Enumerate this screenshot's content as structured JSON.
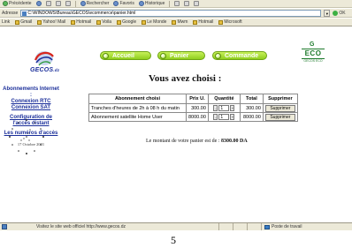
{
  "browser": {
    "toolbar": [
      "Précédente",
      "Rechercher",
      "Favoris",
      "Historique"
    ],
    "address_label": "Adresse",
    "address_value": "C:\\WINDOWS\\Bureau\\GECOS\\ecommerce\\panier.html",
    "go_label": "OK",
    "links": [
      "Link",
      "Gmail",
      "Yahoo! Mail",
      "Hotmail",
      "Voila",
      "Google",
      "Le Monde",
      "Mwm",
      "Hotmail",
      "Microsoft"
    ]
  },
  "header": {
    "logo": "GECOS",
    "logo_suffix": ".dz",
    "nav": [
      "Accueil",
      "Panier",
      "Commande"
    ],
    "eco_logo": {
      "top": "G",
      "main": "ECO",
      "sub": "GECOS ECO"
    }
  },
  "sidebar": {
    "section_title": "Abonnements Internet :",
    "links": [
      "Connexion RTC",
      "Connexion SAT"
    ],
    "config_link": "Configuration de l'accès distant",
    "numbers_link": "Les numéros d'accès",
    "date": "17 Octobre 2001"
  },
  "main": {
    "title": "Vous avez choisi :",
    "columns": [
      "Abonnement choisi",
      "Prix U.",
      "Quantité",
      "Total",
      "Supprimer"
    ],
    "rows": [
      {
        "name": "Tranches d'heures de 2h à 08 h du matin",
        "price": "300.00",
        "qty": "1",
        "total": "300.00",
        "delete": "Supprimer"
      },
      {
        "name": "Abonnement satellite Home User",
        "price": "8000.00",
        "qty": "1",
        "total": "8000.00",
        "delete": "Supprimer"
      }
    ],
    "total_text": "Le montant de votre panier est de :",
    "total_amount": "8300.00 DA"
  },
  "statusbar": {
    "text": "Visitez le site web officiel http://www.gecos.dz",
    "zone": "Poste de travail"
  },
  "page_number": "5",
  "colors": {
    "nav_green": "#8fcf1e",
    "link_blue": "#1b2f9a",
    "eco_green": "#1c7a2b"
  }
}
